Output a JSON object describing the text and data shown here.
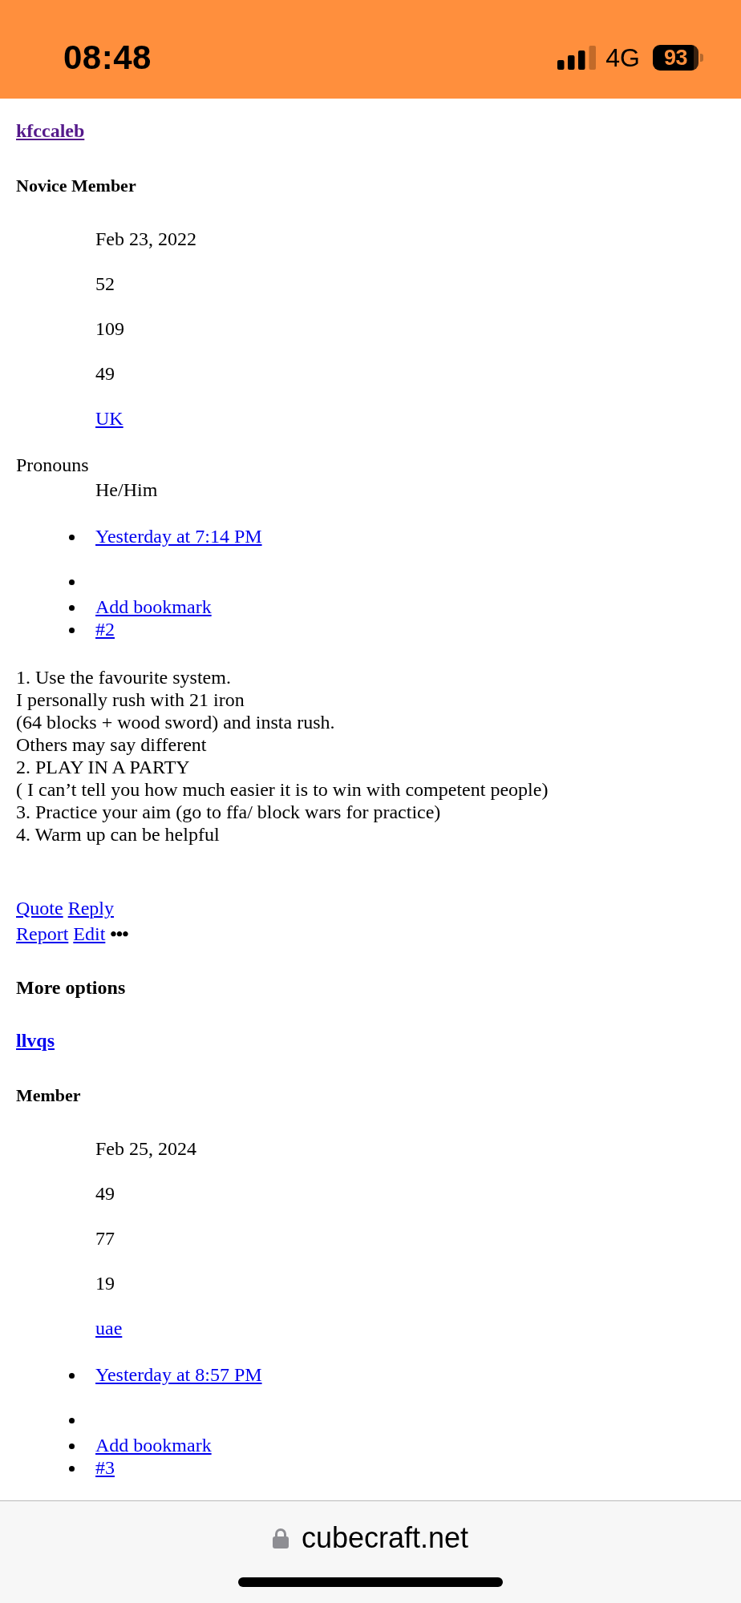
{
  "status_bar": {
    "time": "08:48",
    "network": "4G",
    "battery": "93"
  },
  "posts": [
    {
      "author": {
        "name": "kfccaleb",
        "visited": true
      },
      "role": "Novice Member",
      "stats": [
        {
          "kind": "text",
          "value": "Feb 23, 2022"
        },
        {
          "kind": "text",
          "value": "52"
        },
        {
          "kind": "text",
          "value": "109"
        },
        {
          "kind": "text",
          "value": "49"
        },
        {
          "kind": "link",
          "value": "UK"
        }
      ],
      "fields": [
        {
          "label": "Pronouns",
          "value": "He/Him"
        }
      ],
      "meta": [
        {
          "kind": "date",
          "label": "Yesterday at 7:14 PM"
        },
        {
          "kind": "empty"
        },
        {
          "kind": "bookmark",
          "label": "Add bookmark"
        },
        {
          "kind": "permalink",
          "label": "#2"
        }
      ],
      "body": [
        "1. Use the favourite system.",
        "I personally rush with 21 iron",
        "(64 blocks + wood sword) and insta rush.",
        "Others may say different",
        "2. PLAY IN A PARTY",
        "( I can’t tell you how much easier it is to win with competent people)",
        "3. Practice your aim (go to ffa/ block wars for practice)",
        "4. Warm up can be helpful"
      ],
      "action_rows": [
        [
          {
            "kind": "quote",
            "label": "Quote"
          },
          {
            "kind": "reply",
            "label": "Reply"
          }
        ],
        [
          {
            "kind": "report",
            "label": "Report"
          },
          {
            "kind": "edit",
            "label": "Edit"
          },
          {
            "kind": "menu",
            "label": "•••"
          }
        ]
      ],
      "menu_heading": "More options"
    },
    {
      "author": {
        "name": "llvqs",
        "visited": false
      },
      "role": "Member",
      "stats": [
        {
          "kind": "text",
          "value": "Feb 25, 2024"
        },
        {
          "kind": "text",
          "value": "49"
        },
        {
          "kind": "text",
          "value": "77"
        },
        {
          "kind": "text",
          "value": "19"
        },
        {
          "kind": "link",
          "value": "uae"
        }
      ],
      "meta": [
        {
          "kind": "date",
          "label": "Yesterday at 8:57 PM"
        },
        {
          "kind": "empty"
        },
        {
          "kind": "bookmark",
          "label": "Add bookmark"
        },
        {
          "kind": "permalink",
          "label": "#3"
        }
      ]
    }
  ],
  "address_bar": {
    "domain": "cubecraft.net",
    "secure": true
  }
}
